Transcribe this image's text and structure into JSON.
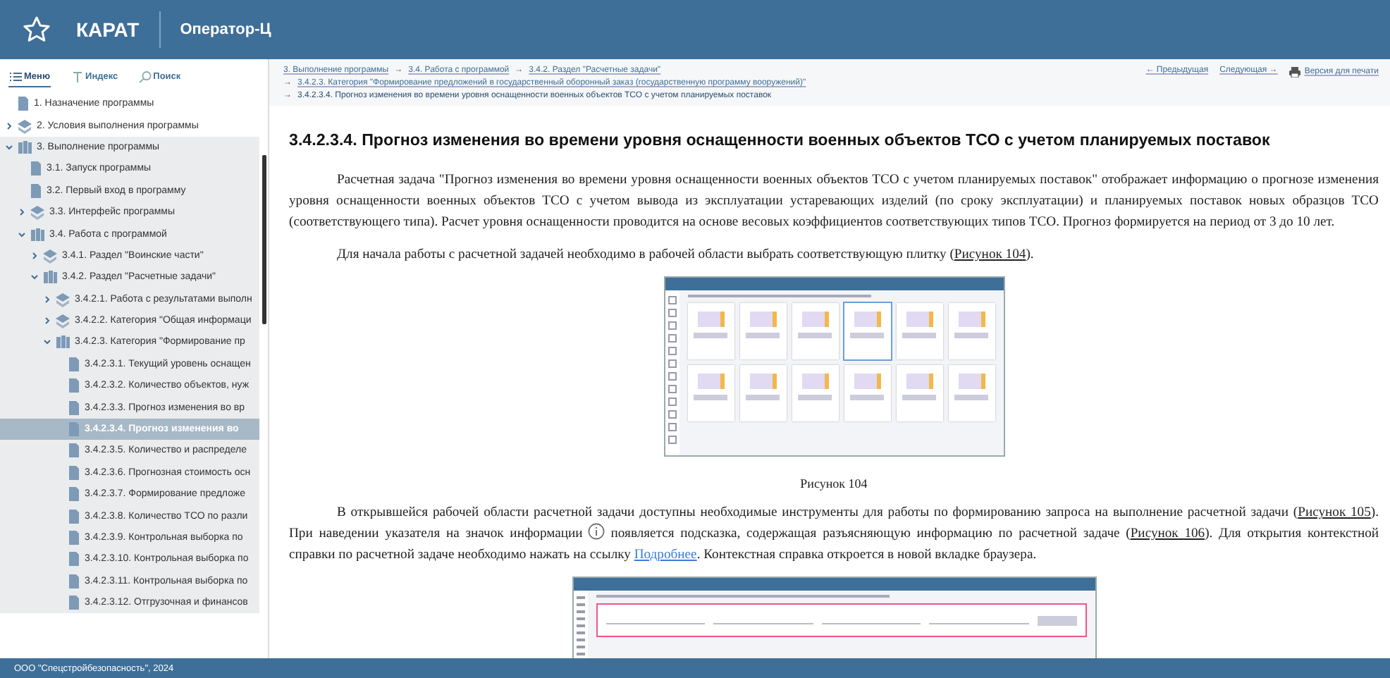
{
  "header": {
    "logo": "КАРАТ",
    "product": "Оператор-Ц"
  },
  "sidebar": {
    "tabs": [
      {
        "label": "Меню",
        "kind": "menu",
        "selected": true
      },
      {
        "label": "Индекс",
        "kind": "index",
        "selected": false
      },
      {
        "label": "Поиск",
        "kind": "search",
        "selected": false
      }
    ],
    "tree": [
      {
        "label": "1. Назначение программы",
        "kind": "page",
        "selected": false
      },
      {
        "label": "2. Условия выполнения программы",
        "kind": "group",
        "expanded": false,
        "selected": false
      },
      {
        "label": "3. Выполнение программы",
        "kind": "group",
        "expanded": true,
        "selected": false,
        "children": [
          {
            "label": "3.1. Запуск программы",
            "kind": "page",
            "selected": false
          },
          {
            "label": "3.2. Первый вход в программу",
            "kind": "page",
            "selected": false
          },
          {
            "label": "3.3. Интерфейс программы",
            "kind": "group",
            "expanded": false,
            "selected": false
          },
          {
            "label": "3.4. Работа с программой",
            "kind": "group",
            "expanded": true,
            "selected": false,
            "children": [
              {
                "label": "3.4.1. Раздел \"Воинские части\"",
                "kind": "group",
                "expanded": false,
                "selected": false
              },
              {
                "label": "3.4.2. Раздел \"Расчетные задачи\"",
                "kind": "group",
                "expanded": true,
                "selected": false,
                "children": [
                  {
                    "label": "3.4.2.1. Работа с результатами выполн",
                    "kind": "group",
                    "expanded": false,
                    "selected": false
                  },
                  {
                    "label": "3.4.2.2. Категория \"Общая информаци",
                    "kind": "group",
                    "expanded": false,
                    "selected": false
                  },
                  {
                    "label": "3.4.2.3. Категория \"Формирование пр",
                    "kind": "group",
                    "expanded": true,
                    "selected": false,
                    "children": [
                      {
                        "label": "3.4.2.3.1. Текущий уровень оснащен",
                        "kind": "page",
                        "selected": false
                      },
                      {
                        "label": "3.4.2.3.2. Количество объектов, нуж",
                        "kind": "page",
                        "selected": false
                      },
                      {
                        "label": "3.4.2.3.3. Прогноз изменения во вр",
                        "kind": "page",
                        "selected": false
                      },
                      {
                        "label": "3.4.2.3.4. Прогноз изменения во",
                        "kind": "page",
                        "selected": true
                      },
                      {
                        "label": "3.4.2.3.5. Количество и распределе",
                        "kind": "page",
                        "selected": false
                      },
                      {
                        "label": "3.4.2.3.6. Прогнозная стоимость осн",
                        "kind": "page",
                        "selected": false
                      },
                      {
                        "label": "3.4.2.3.7. Формирование предложе",
                        "kind": "page",
                        "selected": false
                      },
                      {
                        "label": "3.4.2.3.8. Количество ТСО по разли",
                        "kind": "page",
                        "selected": false
                      },
                      {
                        "label": "3.4.2.3.9. Контрольная выборка по",
                        "kind": "page",
                        "selected": false
                      },
                      {
                        "label": "3.4.2.3.10. Контрольная выборка по",
                        "kind": "page",
                        "selected": false
                      },
                      {
                        "label": "3.4.2.3.11. Контрольная выборка по",
                        "kind": "page",
                        "selected": false
                      },
                      {
                        "label": "3.4.2.3.12. Отгрузочная и финансов",
                        "kind": "page",
                        "selected": false
                      }
                    ]
                  }
                ]
              }
            ]
          }
        ]
      }
    ]
  },
  "breadcrumbs": {
    "separator": "→",
    "lines": [
      {
        "items": [
          {
            "label": "3. Выполнение программы",
            "kind": "link"
          },
          {
            "label": "3.4. Работа с программой",
            "kind": "link"
          },
          {
            "label": "3.4.2. Раздел \"Расчетные задачи\"",
            "kind": "link"
          }
        ]
      },
      {
        "items": [
          {
            "label": "3.4.2.3. Категория \"Формирование предложений в государственный оборонный заказ (государственную программу вооружений)\"",
            "kind": "link"
          }
        ]
      },
      {
        "items": [
          {
            "label": "3.4.2.3.4. Прогноз изменения во времени уровня оснащенности военных объектов ТСО с учетом планируемых поставок",
            "kind": "current"
          }
        ]
      }
    ]
  },
  "nav": [
    {
      "label": "← Предыдущая",
      "kind": "link"
    },
    {
      "label": "Следующая →",
      "kind": "link"
    },
    {
      "label": "Версия для печати",
      "kind": "print"
    }
  ],
  "heading": "3.4.2.3.4. Прогноз изменения во времени уровня оснащенности военных объектов ТСО с учетом планируемых поставок",
  "blocks": [
    {
      "kind": "paragraph",
      "parts": [
        {
          "kind": "text",
          "text": "Расчетная задача \"Прогноз изменения во времени уровня оснащенности военных объектов ТСО с учетом планируемых поставок\" отображает информацию о прогнозе изменения уровня оснащенности военных объектов ТСО с учетом вывода из эксплуатации устаревающих изделий (по сроку эксплуатации) и планируемых поставок новых образцов ТСО (соответствующего типа). Расчет уровня оснащенности проводится на основе весовых коэффициентов соответствующих типов ТСО. Прогноз формируется на период от 3 до 10 лет."
        }
      ]
    },
    {
      "kind": "paragraph",
      "parts": [
        {
          "kind": "text",
          "text": "Для начала работы с расчетной задачей необходимо в рабочей области выбрать соответствующую плитку ("
        },
        {
          "kind": "link",
          "text": "Рисунок 104"
        },
        {
          "kind": "text",
          "text": ")."
        }
      ]
    },
    {
      "kind": "figure",
      "screenshot": {
        "kind": "tiles"
      },
      "caption": "Рисунок 104"
    },
    {
      "kind": "paragraph",
      "parts": [
        {
          "kind": "text",
          "text": "В открывшейся рабочей области расчетной задачи доступны необходимые инструменты для работы по формированию запроса на выполнение расчетной задачи ("
        },
        {
          "kind": "link",
          "text": "Рисунок 105"
        },
        {
          "kind": "text",
          "text": "). При наведении указателя на значок информации"
        },
        {
          "kind": "info"
        },
        {
          "kind": "text",
          "text": "появляется подсказка, содержащая разъясняющую информацию по расчетной задаче ("
        },
        {
          "kind": "link",
          "text": "Рисунок 106"
        },
        {
          "kind": "text",
          "text": "). Для открытия контекстной справки по расчетной задаче необходимо нажать на ссылку "
        },
        {
          "kind": "weblink",
          "text": "Подробнее"
        },
        {
          "kind": "text",
          "text": ". Контекстная справка откроется в новой вкладке браузера."
        }
      ]
    },
    {
      "kind": "figure",
      "screenshot": {
        "kind": "form"
      }
    }
  ],
  "footer": "ООО \"Спецстройбезопасность\", 2024"
}
